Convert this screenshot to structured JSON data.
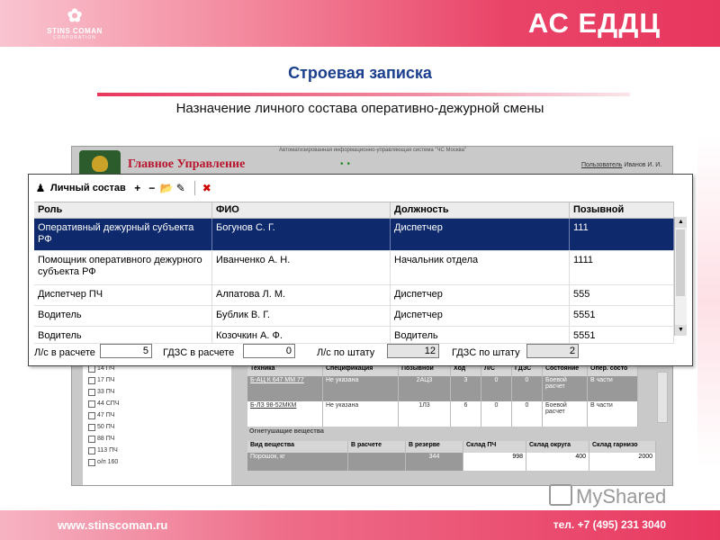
{
  "header": {
    "logo_name": "STINS COMAN",
    "logo_sub": "CORPORATION",
    "brand": "АС ЕДДЦ"
  },
  "page": {
    "title": "Строевая записка",
    "subtitle": "Назначение личного состава оперативно-дежурной смены"
  },
  "background_app": {
    "system_name": "Автоматизированная информационно-управляющая система \"ЧС Москва\"",
    "org_title": "Главное Управление",
    "user_label": "Пользователь",
    "user_name": "Иванов И. И.",
    "tree_items": [
      "14 ПЧ",
      "17 ПЧ",
      "33 ПЧ",
      "44 СПЧ",
      "47 ПЧ",
      "50 ПЧ",
      "88 ПЧ",
      "113 ПЧ",
      "о/п 160"
    ],
    "tech_headers": [
      "Техника",
      "Спецификация",
      "Позывной",
      "Ход",
      "Л/С",
      "ГДЗС",
      "Состояние",
      "Опер. состо"
    ],
    "tech_rows": [
      [
        "Б-АЦ К 647 ММ 77",
        "Не указана",
        "2АЦ3",
        "3",
        "0",
        "0",
        "Боевой расчет",
        "В части"
      ],
      [
        "Б-ЛЗ 98-52МКМ",
        "Не указана",
        "1Л3",
        "6",
        "0",
        "0",
        "Боевой расчет",
        "В части"
      ]
    ],
    "agents_title": "Огнетушащие вещества",
    "agent_headers": [
      "Вид вещества",
      "В расчете",
      "В резерве",
      "Склад ПЧ",
      "Склад округа",
      "Склад гарнизо"
    ],
    "agent_row": [
      "Порошок, кг",
      "",
      "344",
      "998",
      "400",
      "2000"
    ]
  },
  "dialog": {
    "toolbar_label": "Личный состав",
    "icons": [
      "staff-icon",
      "add-icon",
      "remove-icon",
      "open-icon",
      "edit-icon",
      "delete-icon"
    ],
    "columns": [
      "Роль",
      "ФИО",
      "Должность",
      "Позывной"
    ],
    "rows": [
      [
        "Оперативный дежурный субъекта РФ",
        "Богунов С. Г.",
        "Диспетчер",
        "111"
      ],
      [
        "Помощник оперативного дежурного субъекта РФ",
        "Иванченко А. Н.",
        "Начальник отдела",
        "1111"
      ],
      [
        "Диспетчер ПЧ",
        "Алпатова Л. М.",
        "Диспетчер",
        "555"
      ],
      [
        "Водитель",
        "Бублик В. Г.",
        "Диспетчер",
        "5551"
      ],
      [
        "Водитель",
        "Козочкин А. Ф.",
        "Водитель",
        "5551"
      ]
    ],
    "selected_row": 0,
    "footer": {
      "ls_calc_label": "Л/с в расчете",
      "ls_calc_value": "5",
      "gdzs_calc_label": "ГДЗС в расчете",
      "gdzs_calc_value": "0",
      "ls_staff_label": "Л/с по штату",
      "ls_staff_value": "12",
      "gdzs_staff_label": "ГДЗС по штату",
      "gdzs_staff_value": "2"
    }
  },
  "watermark": "MyShared",
  "footer": {
    "site": "www.stinscoman.ru",
    "phone": "тел. +7 (495) 231 3040"
  },
  "colors": {
    "accent": "#e8375f",
    "title_blue": "#1b3f8e",
    "selection": "#0e2a6c"
  }
}
